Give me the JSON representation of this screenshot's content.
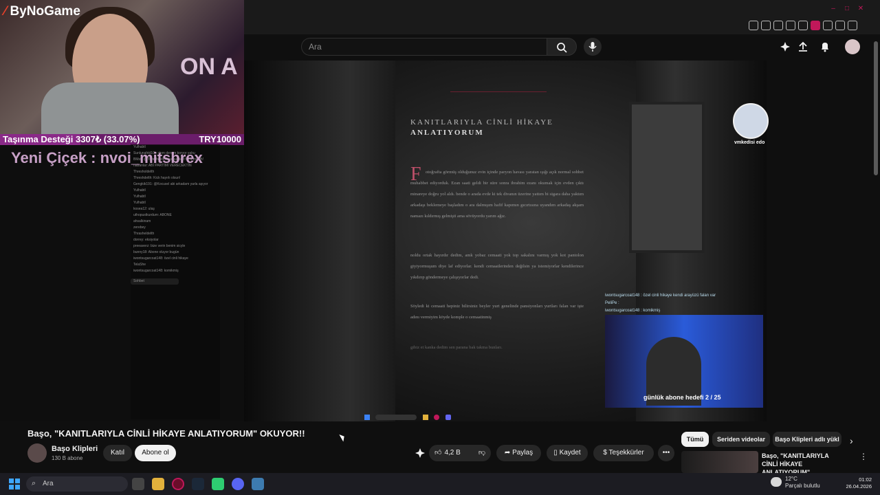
{
  "stream_overlay": {
    "brand": "ByNoGame",
    "on_air": "ON A",
    "donation_label": "Taşınma Desteği 3307₺ (33.07%)",
    "donation_goal": "TRY10000",
    "donation_progress": 0.3307,
    "alert_text": "Yeni Çiçek : nvoi_mitsbrex",
    "chat_lines": [
      "Yulhabtl",
      "Sunlunahtd10k: dem dersim koryor yahu",
      "BMstl: @Threshdelth has subbed for 1 month!",
      "nabanlar: ABİ PARTİMİ VERECEKTİN",
      "Thresholdelth",
      "Threshdelth: Kick hayırlı olsun!",
      "Gengkik191: @Kocusel abi arkadam yarla aşıyor",
      "Yulhabtl",
      "Yulhabtl",
      "Yulhabtl",
      "kosea12: ulaş",
      "uthopustkurdum: ABONE",
      "ahsalkinam",
      "zerebey",
      "Thrasheldelth",
      "dorrey: eksiyolar",
      "preeaverz: bize verin benim sicyle",
      "bunny18: Abone oluyor bugün",
      "iwontsugarcoat148: özel cinli hikaye",
      "TelaShe",
      "iwontsugarcoat148: komikmiş"
    ],
    "chat_send": "Sohbet",
    "viewer_name": "vmkedisi edo",
    "cam2_chat": [
      "iwontsugarcoat148 : özel cinli hikaye kendi arayüzü falan var",
      "PeliPe :",
      "iwontsugarcoat148 : komikmiş"
    ],
    "cam2_caption": "günlük abone hedefi 2 / 25"
  },
  "browser": {
    "win_controls": [
      "–",
      "□",
      "✕"
    ],
    "extensions": [
      "pin-icon",
      "tab-icon",
      "shield-icon",
      "play-icon",
      "heart-icon",
      "puzzle-icon",
      "profile-icon",
      "star-icon",
      "menu-icon"
    ]
  },
  "youtube": {
    "search_placeholder": "Ara",
    "header_icons": [
      "create-icon",
      "upload-icon",
      "bell-icon",
      "avatar"
    ],
    "video_doc": {
      "title_line1": "KANITLARIYLA CİNLİ HİKAYE",
      "title_line2": "ANLATIYORUM",
      "drop_cap": "F",
      "paragraph1": "otoğrafta görmüş olduğunuz evin içinde paryon havası yaratan ışığı açık normal sohbet muhabbet ediyorduk. Ezan saati geldi bir süre sonra ibrahim ezanı okumak için evden çıktı minareye doğru yol aldı. bende o arada evde ki tek divanın üzerine yattım bi sigara daha yaktım arkadaşı beklemeye başladım o ara dalmışım hafif kapımın gıcırtısına uyandım arkadaş akşam namazı kıldırmış gelmişti ama sövüyordu yarım ağız.",
      "paragraph2": "noldu ortak hayırdır dedim, amk yobaz cemaati yok top sakalını varmış yok kot pantolon giyiyormuşum diye laf ediyorlar. kendi cemaatlerinden değilsin ya istemiyorlar kendilerince yıkdırıp göndermeye çalışıyorlar dedi.",
      "paragraph3": "Söyledi ki cemaati hepiniz bilirsiniz beyler yurt genelinde pansiyonları yurtları falan var işte adını vermiyim köyde komple o cemaatinmiş",
      "paragraph4": "gibiz et kanka dedim sen parana bak takma bunları."
    },
    "video_title": "Başo, \"KANITLARIYLA CİNLİ HİKAYE ANLATIYORUM\" OKUYOR!!",
    "channel_name": "Başo Klipleri",
    "subscriber_count": "130 B abone",
    "join_label": "Katıl",
    "subscribe_label": "Abone ol",
    "like_count": "4,2 B",
    "share_label": "Paylaş",
    "save_label": "Kaydet",
    "thanks_label": "Teşekkürler",
    "chips": [
      "Tümü",
      "Seriden videolar",
      "Başo Klipleri adlı yükl"
    ],
    "rec_title": "Başo, \"KANITLARIYLA CİNLİ HİKAYE ANLATIYORUM\" ..."
  },
  "taskbar": {
    "search_placeholder": "Ara",
    "weather_temp": "12°C",
    "weather_desc": "Parçalı bulutlu",
    "time": "01:02",
    "date": "26.04.2026"
  },
  "colors": {
    "accent": "#c0185a",
    "donation_bar": "#6b1d6a",
    "youtube_bg": "#0f0f0f"
  }
}
